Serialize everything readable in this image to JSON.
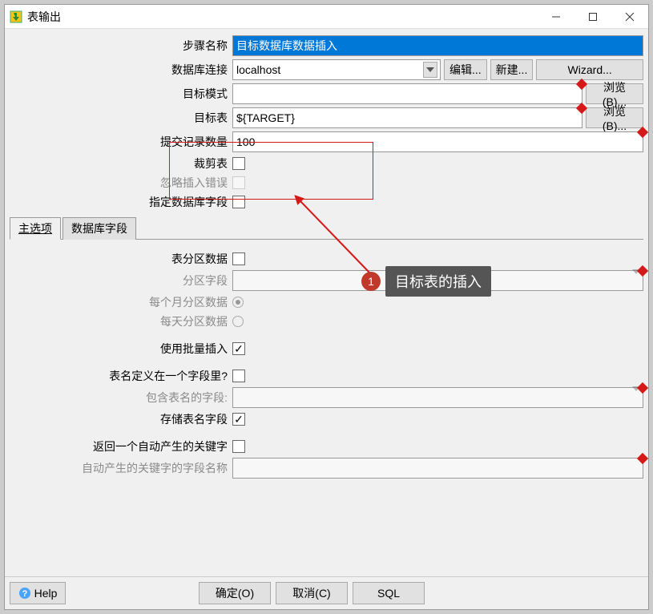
{
  "window": {
    "title": "表输出"
  },
  "form": {
    "step_name_label": "步骤名称",
    "step_name_value": "目标数据库数据插入",
    "db_conn_label": "数据库连接",
    "db_conn_value": "localhost",
    "edit_btn": "编辑...",
    "new_btn": "新建...",
    "wizard_btn": "Wizard...",
    "target_schema_label": "目标模式",
    "target_schema_value": "",
    "browse_btn": "浏览(B)...",
    "target_table_label": "目标表",
    "target_table_value": "${TARGET}",
    "commit_size_label": "提交记录数量",
    "commit_size_value": "100",
    "truncate_label": "裁剪表",
    "ignore_insert_err_label": "忽略插入错误",
    "specify_db_fields_label": "指定数据库字段"
  },
  "tabs": {
    "main": "主选项",
    "fields": "数据库字段"
  },
  "panel": {
    "partition_data_label": "表分区数据",
    "partition_field_label": "分区字段",
    "partition_monthly_label": "每个月分区数据",
    "partition_daily_label": "每天分区数据",
    "use_batch_insert_label": "使用批量插入",
    "tablename_in_field_label": "表名定义在一个字段里?",
    "tablename_field_label": "包含表名的字段:",
    "store_tablename_field_label": "存储表名字段",
    "return_autogen_key_label": "返回一个自动产生的关键字",
    "autogen_key_fieldname_label": "自动产生的关键字的字段名称"
  },
  "bottom": {
    "help": "Help",
    "ok": "确定(O)",
    "cancel": "取消(C)",
    "sql": "SQL"
  },
  "annotation": {
    "num": "1",
    "text": "目标表的插入"
  }
}
